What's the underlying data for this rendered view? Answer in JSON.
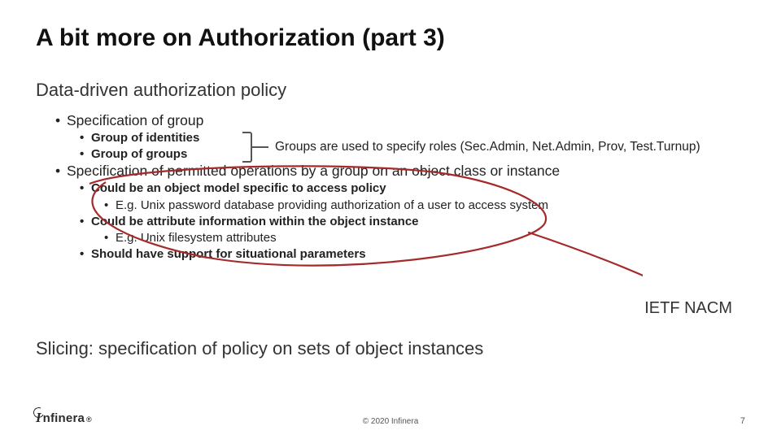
{
  "title": "A bit more on Authorization (part 3)",
  "subtitle": "Data-driven authorization policy",
  "bullets": {
    "spec_group": "Specification of group",
    "group_identities": "Group of identities",
    "group_groups": "Group of groups",
    "bracket_note": "Groups are used to specify roles (Sec.Admin, Net.Admin, Prov, Test.Turnup)",
    "spec_permitted": "Specification of permitted operations by a group on an object class or instance",
    "could_obj_model": "Could be an object model specific to access policy",
    "eg_unix_pass": "E.g. Unix password database providing authorization of a user to access system",
    "could_attr_info": "Could be attribute information within the object instance",
    "eg_unix_fs": "E.g. Unix filesystem attributes",
    "should_support": "Should have support for situational parameters"
  },
  "ietf_label": "IETF NACM",
  "slicing_subtitle": "Slicing: specification of policy on sets of object instances",
  "footer": {
    "logo_mark": "I",
    "logo_word": "nfinera",
    "logo_reg": "®",
    "copyright": "© 2020 Infinera",
    "page": "7"
  }
}
